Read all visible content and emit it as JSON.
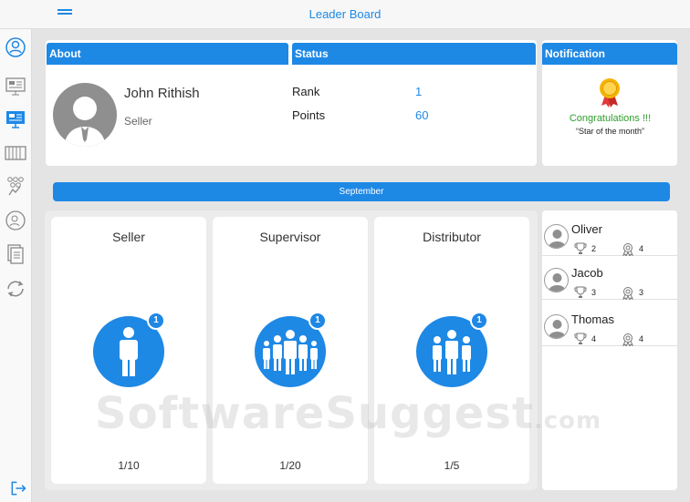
{
  "header": {
    "title": "Leader Board"
  },
  "sidebar": {
    "items": [
      {
        "icon": "profile-icon"
      },
      {
        "icon": "dashboard-icon"
      },
      {
        "icon": "leaderboard-icon"
      },
      {
        "icon": "inventory-icon"
      },
      {
        "icon": "team-icon"
      },
      {
        "icon": "user-card-icon"
      },
      {
        "icon": "documents-icon"
      },
      {
        "icon": "sync-icon"
      },
      {
        "icon": "logout-icon"
      }
    ]
  },
  "about": {
    "header": "About",
    "name": "John Rithish",
    "role": "Seller"
  },
  "status": {
    "header": "Status",
    "rank_label": "Rank",
    "rank_value": "1",
    "points_label": "Points",
    "points_value": "60"
  },
  "notification": {
    "header": "Notification",
    "congrats": "Congratulations !!!",
    "message": "“Star of the month”"
  },
  "month": "September",
  "categories": [
    {
      "title": "Seller",
      "badge": "1",
      "score": "1/10"
    },
    {
      "title": "Supervisor",
      "badge": "1",
      "score": "1/20"
    },
    {
      "title": "Distributor",
      "badge": "1",
      "score": "1/5"
    }
  ],
  "leaders": [
    {
      "name": "Oliver",
      "trophies": "2",
      "awards": "4"
    },
    {
      "name": "Jacob",
      "trophies": "3",
      "awards": "3"
    },
    {
      "name": "Thomas",
      "trophies": "4",
      "awards": "4"
    }
  ],
  "watermark": {
    "main": "SoftwareSuggest",
    "suffix": ".com"
  },
  "colors": {
    "accent": "#1e88e5",
    "congrats": "#2e9d2e",
    "background": "#e4e4e4"
  }
}
